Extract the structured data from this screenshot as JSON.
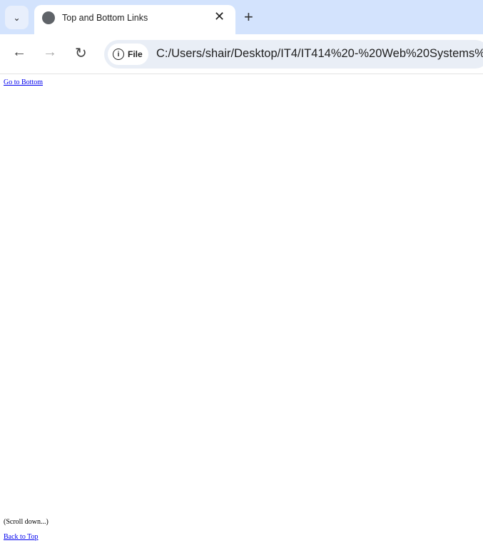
{
  "browser": {
    "tab_title": "Top and Bottom Links",
    "address_chip": "File",
    "url": "C:/Users/shair/Desktop/IT4/IT414%20-%20Web%20Systems%",
    "icons": {
      "tab_menu": "chevron-down-icon",
      "tab": "globe-icon",
      "close": "close-icon",
      "new_tab": "plus-icon",
      "back": "arrow-left-icon",
      "forward": "arrow-right-icon",
      "reload": "reload-icon",
      "info": "info-icon"
    }
  },
  "page": {
    "go_to_bottom": "Go to Bottom",
    "scroll_note": "(Scroll down...)",
    "back_to_top": "Back to Top"
  }
}
